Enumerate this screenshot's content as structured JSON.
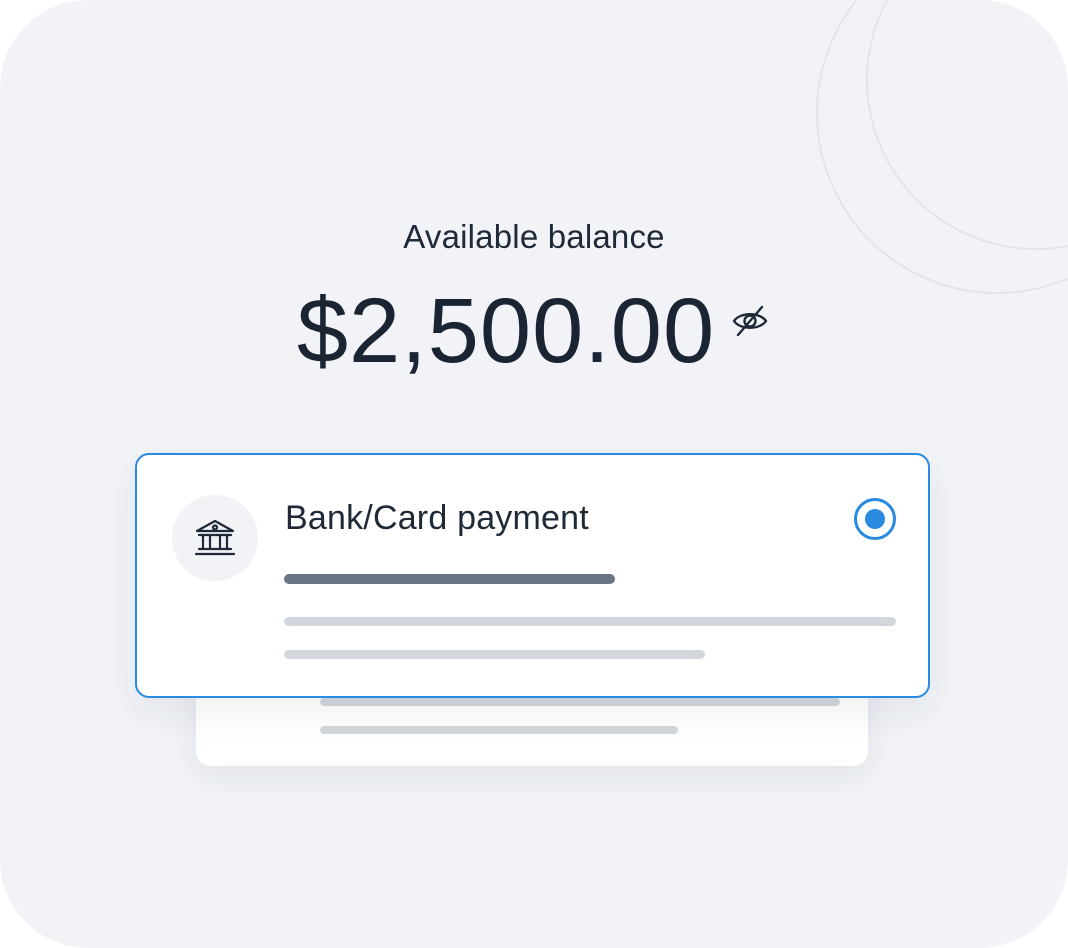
{
  "balance": {
    "label": "Available balance",
    "amount": "$2,500.00",
    "toggle_icon": "eye-off-icon"
  },
  "payment_option": {
    "icon": "bank-icon",
    "title": "Bank/Card payment",
    "selected": true
  },
  "colors": {
    "accent": "#2a8ae0",
    "background": "#f1f3f7",
    "text": "#1f2937",
    "skeleton_dark": "#6b7483",
    "skeleton_light": "#d2d6dd"
  }
}
